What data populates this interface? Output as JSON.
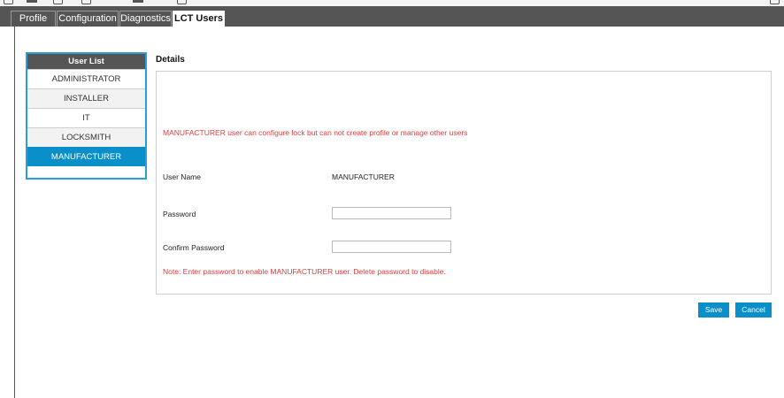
{
  "tabs": [
    {
      "label": "Profile",
      "active": false
    },
    {
      "label": "Configuration",
      "active": false
    },
    {
      "label": "Diagnostics",
      "active": false
    },
    {
      "label": "LCT Users",
      "active": true
    }
  ],
  "user_list": {
    "header": "User List",
    "items": [
      "ADMINISTRATOR",
      "INSTALLER",
      "IT",
      "LOCKSMITH",
      "MANUFACTURER"
    ],
    "selected": "MANUFACTURER"
  },
  "details": {
    "title": "Details",
    "info_message": "MANUFACTURER user can configure lock but can not create profile or manage other users",
    "username_label": "User Name",
    "username_value": "MANUFACTURER",
    "password_label": "Password",
    "password_value": "",
    "confirm_label": "Confirm Password",
    "confirm_value": "",
    "note": "Note: Enter password to enable MANUFACTURER user. Delete password to disable."
  },
  "buttons": {
    "save": "Save",
    "cancel": "Cancel"
  },
  "colors": {
    "accent": "#0b8fc9",
    "header_gray": "#555555",
    "warning_red": "#e03a3a"
  }
}
